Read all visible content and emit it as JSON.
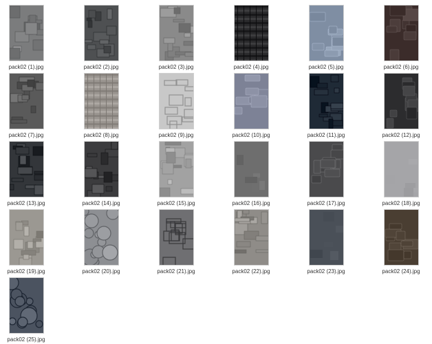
{
  "files": [
    {
      "name": "pack02 (1).jpg",
      "tone": "#7b7c7d",
      "style": "panels"
    },
    {
      "name": "pack02 (2).jpg",
      "tone": "#4e5052",
      "style": "panels"
    },
    {
      "name": "pack02 (3).jpg",
      "tone": "#8a8a8a",
      "style": "blocks"
    },
    {
      "name": "pack02 (4).jpg",
      "tone": "#2a2a2c",
      "style": "stripes"
    },
    {
      "name": "pack02 (5).jpg",
      "tone": "#7f8ea3",
      "style": "tech"
    },
    {
      "name": "pack02 (6).jpg",
      "tone": "#3b2c2a",
      "style": "tech"
    },
    {
      "name": "pack02 (7).jpg",
      "tone": "#5a5a5a",
      "style": "panels"
    },
    {
      "name": "pack02 (8).jpg",
      "tone": "#9a9590",
      "style": "stripes"
    },
    {
      "name": "pack02 (9).jpg",
      "tone": "#c8c8c8",
      "style": "grid"
    },
    {
      "name": "pack02 (10).jpg",
      "tone": "#7d8296",
      "style": "tech"
    },
    {
      "name": "pack02 (11).jpg",
      "tone": "#1f2a36",
      "style": "blocks"
    },
    {
      "name": "pack02 (12).jpg",
      "tone": "#2c2c2e",
      "style": "tech"
    },
    {
      "name": "pack02 (13).jpg",
      "tone": "#33363a",
      "style": "blocks"
    },
    {
      "name": "pack02 (14).jpg",
      "tone": "#3c3c3e",
      "style": "panels"
    },
    {
      "name": "pack02 (15).jpg",
      "tone": "#a2a2a2",
      "style": "blocks"
    },
    {
      "name": "pack02 (16).jpg",
      "tone": "#6e6e6e",
      "style": "plain"
    },
    {
      "name": "pack02 (17).jpg",
      "tone": "#4a4a4c",
      "style": "tech"
    },
    {
      "name": "pack02 (18).jpg",
      "tone": "#a5a5a8",
      "style": "plain"
    },
    {
      "name": "pack02 (19).jpg",
      "tone": "#9b9892",
      "style": "panels"
    },
    {
      "name": "pack02 (20).jpg",
      "tone": "#8d8f93",
      "style": "cells"
    },
    {
      "name": "pack02 (21).jpg",
      "tone": "#6f6f72",
      "style": "grid"
    },
    {
      "name": "pack02 (22).jpg",
      "tone": "#8f8c88",
      "style": "blocks"
    },
    {
      "name": "pack02 (23).jpg",
      "tone": "#4a5058",
      "style": "plain"
    },
    {
      "name": "pack02 (24).jpg",
      "tone": "#4a3e32",
      "style": "tech"
    },
    {
      "name": "pack02 (25).jpg",
      "tone": "#4b5360",
      "style": "cells"
    }
  ]
}
